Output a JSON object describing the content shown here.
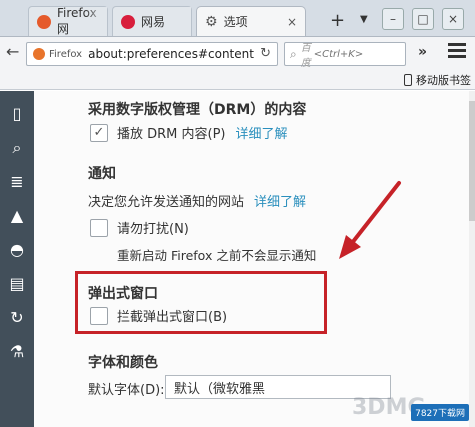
{
  "tabs": [
    {
      "title": "Firefox 网",
      "close": ""
    },
    {
      "title": "网易",
      "close": ""
    },
    {
      "title": "选项",
      "close": "×",
      "active": true
    }
  ],
  "newtab_glyph": "+",
  "window_controls": [
    "–",
    "□",
    "×"
  ],
  "nav": {
    "back_glyph": "←",
    "identity": "Firefox",
    "url": "about:preferences#content",
    "reload_glyph": "↻",
    "search_engine": "百度",
    "search_hint": "<Ctrl+K>",
    "overflow_glyph": "»"
  },
  "bookmarks": {
    "mobile": "移动版书签"
  },
  "sidebar_icons": [
    "general-icon",
    "search-icon",
    "content-icon",
    "applications-icon",
    "privacy-icon",
    "security-icon",
    "sync-icon",
    "advanced-icon"
  ],
  "content": {
    "drm_heading": "采用数字版权管理（DRM）的内容",
    "drm_checkbox_label": "播放 DRM 内容(P)",
    "drm_learn_more": "详细了解",
    "notifications_heading": "通知",
    "notifications_desc": "决定您允许发送通知的网站",
    "notifications_learn_more": "详细了解",
    "dnd_label": "请勿打扰(N)",
    "dnd_desc": "重新启动 Firefox 之前不会显示通知",
    "popups_heading": "弹出式窗口",
    "popups_label": "拦截弹出式窗口(B)",
    "fonts_heading": "字体和颜色",
    "default_font_label": "默认字体(D):",
    "default_font_value": "默认（微软雅黑"
  },
  "watermark": {
    "text": "3DMG",
    "badge": "7827下载网"
  },
  "colors": {
    "highlight": "#c62228",
    "link": "#2a8fbd",
    "sidebar": "#424f5a"
  }
}
